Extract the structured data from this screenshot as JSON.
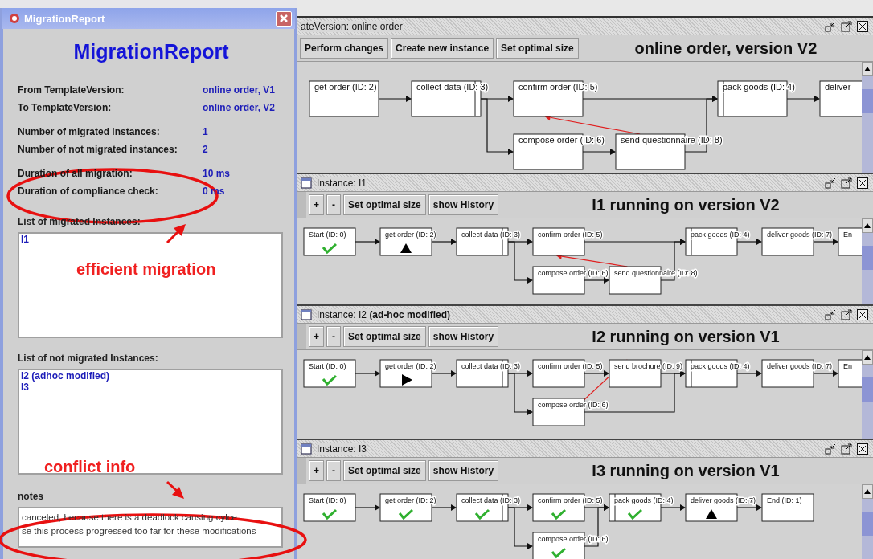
{
  "report_window": {
    "title": "MigrationReport",
    "heading": "MigrationReport",
    "field_groups": [
      [
        {
          "label": "From TemplateVersion:",
          "value": "online order, V1"
        },
        {
          "label": "To TemplateVersion:",
          "value": "online order, V2"
        }
      ],
      [
        {
          "label": "Number of migrated instances:",
          "value": "1"
        },
        {
          "label": "Number of not migrated instances:",
          "value": "2"
        }
      ],
      [
        {
          "label": "Duration of all migration:",
          "value": "10 ms"
        },
        {
          "label": "Duration of compliance check:",
          "value": "0 ms"
        }
      ]
    ],
    "migrated_list": {
      "label": "List of migrated Instances:",
      "items": [
        "I1"
      ]
    },
    "not_migrated_list": {
      "label": "List of not migrated Instances:",
      "items": [
        "I2 (adhoc modified)",
        "I3"
      ]
    },
    "notes": {
      "label": "notes",
      "lines": [
        "canceled, because there is a deadlock causing cylce",
        "se this process progressed too far for these modifications"
      ]
    }
  },
  "annotations": [
    {
      "text": "efficient migration"
    },
    {
      "text": "conflict info"
    }
  ],
  "frames": [
    {
      "kind": "template",
      "title": "ateVersion: online order",
      "buttons": [
        "Perform changes",
        "Create new instance",
        "Set optimal size"
      ],
      "heading": "online order, version V2",
      "nodes": [
        {
          "label": "get order (ID: 2)",
          "kind": "plain"
        },
        {
          "label": "collect data (ID: 3)",
          "kind": "plain"
        },
        {
          "label": "confirm order (ID: 5)",
          "kind": "plain"
        },
        {
          "label": "pack goods (ID: 4)",
          "kind": "plain"
        },
        {
          "label": "deliver",
          "kind": "plain"
        },
        {
          "label": "compose order (ID: 6)",
          "kind": "plain"
        },
        {
          "label": "send questionnaire (ID: 8)",
          "kind": "plain"
        }
      ]
    },
    {
      "kind": "instance",
      "title": "Instance: I1",
      "buttons": [
        "+",
        "-",
        "Set optimal size",
        "show History"
      ],
      "heading": "I1 running on version V2",
      "nodes": [
        {
          "label": "Start (ID: 0)",
          "kind": "completed"
        },
        {
          "label": "get order (ID: 2)",
          "kind": "activated"
        },
        {
          "label": "collect data (ID: 3)",
          "kind": "plain"
        },
        {
          "label": "confirm order (ID: 5)",
          "kind": "plain"
        },
        {
          "label": "pack goods (ID: 4)",
          "kind": "plain"
        },
        {
          "label": "deliver goods (ID: 7)",
          "kind": "plain"
        },
        {
          "label": "En",
          "kind": "plain"
        },
        {
          "label": "compose order (ID: 6)",
          "kind": "plain"
        },
        {
          "label": "send questionnaire (ID: 8)",
          "kind": "plain"
        }
      ]
    },
    {
      "kind": "instance",
      "title": "Instance: I2 **(ad-hoc modified)**",
      "buttons": [
        "+",
        "-",
        "Set optimal size",
        "show History"
      ],
      "heading": "I2 running on version V1",
      "nodes": [
        {
          "label": "Start (ID: 0)",
          "kind": "completed"
        },
        {
          "label": "get order (ID: 2)",
          "kind": "running"
        },
        {
          "label": "collect data (ID: 3)",
          "kind": "plain"
        },
        {
          "label": "confirm order (ID: 5)",
          "kind": "plain"
        },
        {
          "label": "send brochure (ID: 9)",
          "kind": "plain"
        },
        {
          "label": "pack goods (ID: 4)",
          "kind": "plain"
        },
        {
          "label": "deliver goods (ID: 7)",
          "kind": "plain"
        },
        {
          "label": "En",
          "kind": "plain"
        },
        {
          "label": "compose order (ID: 6)",
          "kind": "plain"
        }
      ]
    },
    {
      "kind": "instance",
      "title": "Instance: I3",
      "buttons": [
        "+",
        "-",
        "Set optimal size",
        "show History"
      ],
      "heading": "I3 running on version V1",
      "nodes": [
        {
          "label": "Start (ID: 0)",
          "kind": "completed"
        },
        {
          "label": "get order (ID: 2)",
          "kind": "completed"
        },
        {
          "label": "collect data (ID: 3)",
          "kind": "completed"
        },
        {
          "label": "confirm order (ID: 5)",
          "kind": "completed"
        },
        {
          "label": "pack goods (ID: 4)",
          "kind": "completed"
        },
        {
          "label": "deliver goods (ID: 7)",
          "kind": "activated"
        },
        {
          "label": "End (ID: 1)",
          "kind": "plain"
        },
        {
          "label": "compose order (ID: 6)",
          "kind": "completed"
        }
      ]
    }
  ]
}
